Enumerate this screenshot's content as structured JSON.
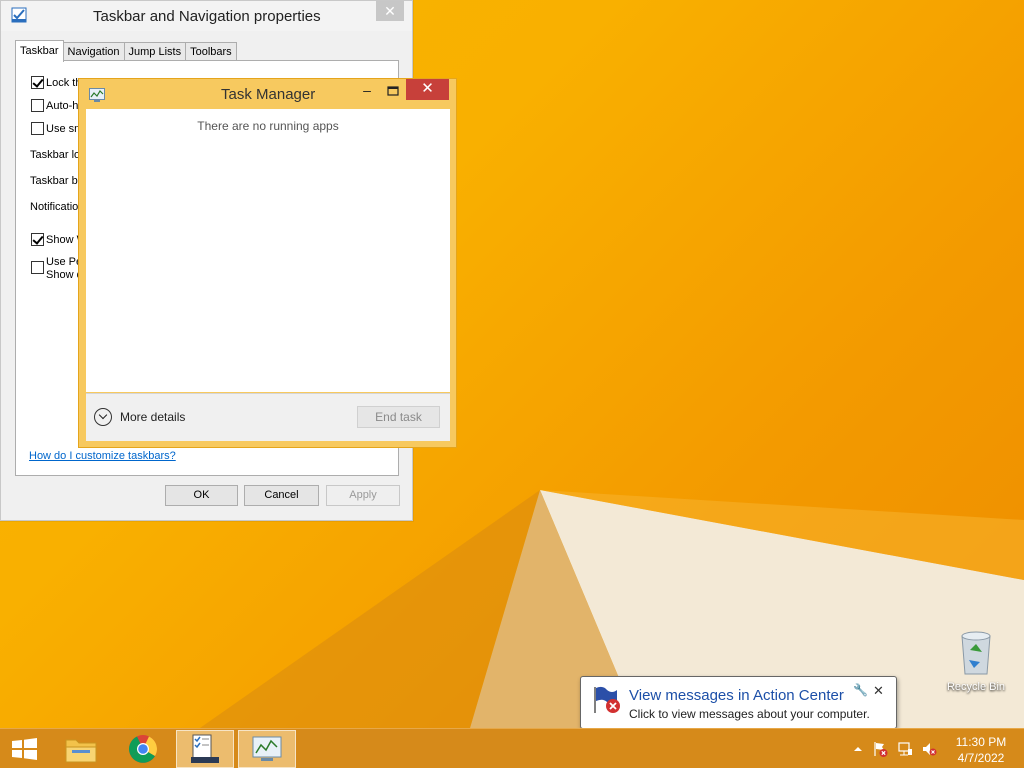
{
  "properties_dialog": {
    "title": "Taskbar and Navigation properties",
    "tabs": [
      "Taskbar",
      "Navigation",
      "Jump Lists",
      "Toolbars"
    ],
    "options": [
      {
        "label": "Lock the taskb",
        "checked": true
      },
      {
        "label": "Auto-h",
        "checked": false
      },
      {
        "label": "Use sm",
        "checked": false
      }
    ],
    "settings_labels": [
      "Taskbar lo",
      "Taskbar bu",
      "Notification"
    ],
    "options2": [
      {
        "label": "Show W",
        "checked": true
      },
      {
        "label_line1": "Use Pe",
        "label_line2": "Show d",
        "checked": false
      }
    ],
    "help_link": "How do I customize taskbars?",
    "ok_label": "OK",
    "cancel_label": "Cancel",
    "apply_label": "Apply"
  },
  "task_manager": {
    "title": "Task Manager",
    "empty_message": "There are no running apps",
    "more_details_label": "More details",
    "end_task_label": "End task"
  },
  "notification": {
    "title": "View messages in Action Center",
    "text": "Click to view messages about your computer."
  },
  "desktop": {
    "recycle_bin_label": "Recycle Bin"
  },
  "taskbar": {
    "time": "11:30 PM",
    "date": "4/7/2022",
    "pinned": [
      "start-button",
      "file-explorer",
      "chrome",
      "taskbar-properties",
      "task-manager"
    ]
  },
  "colors": {
    "wallpaper": "#f5a500",
    "taskbar": "#d68a1a",
    "task_manager_frame": "#f7c95f",
    "close_red": "#c7403a",
    "link": "#0066cc"
  }
}
